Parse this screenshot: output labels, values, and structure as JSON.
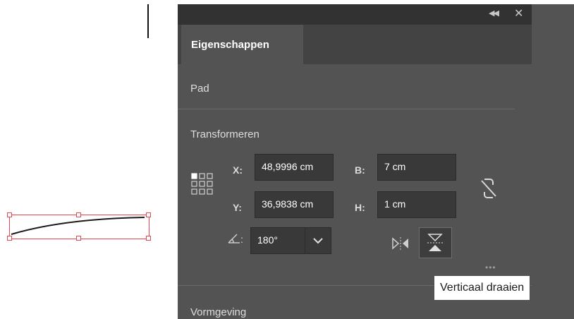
{
  "panel": {
    "tab_label": "Eigenschappen",
    "collapse_icon": "double-chevron-left-icon",
    "close_icon": "close-icon",
    "section_path": "Pad",
    "section_transform": "Transformeren",
    "section_appearance": "Vormgeving"
  },
  "transform": {
    "x_label": "X:",
    "x_value": "48,9996 cm",
    "y_label": "Y:",
    "y_value": "36,9838 cm",
    "w_label": "B:",
    "w_value": "7 cm",
    "h_label": "H:",
    "h_value": "1 cm",
    "angle_label": ":",
    "angle_value": "180°",
    "angle_icon": "angle-icon",
    "link_icon": "unlink-proportions-icon",
    "flip_h_icon": "flip-horizontal-icon",
    "flip_v_icon": "flip-vertical-icon",
    "reference_point_icon": "reference-point-grid-icon"
  },
  "tooltip": "Verticaal draaien",
  "colors": {
    "panel_bg": "#535353",
    "topbar_bg": "#323232",
    "tabbar_bg": "#434343",
    "input_bg": "#393939",
    "selection": "#e8464e"
  }
}
